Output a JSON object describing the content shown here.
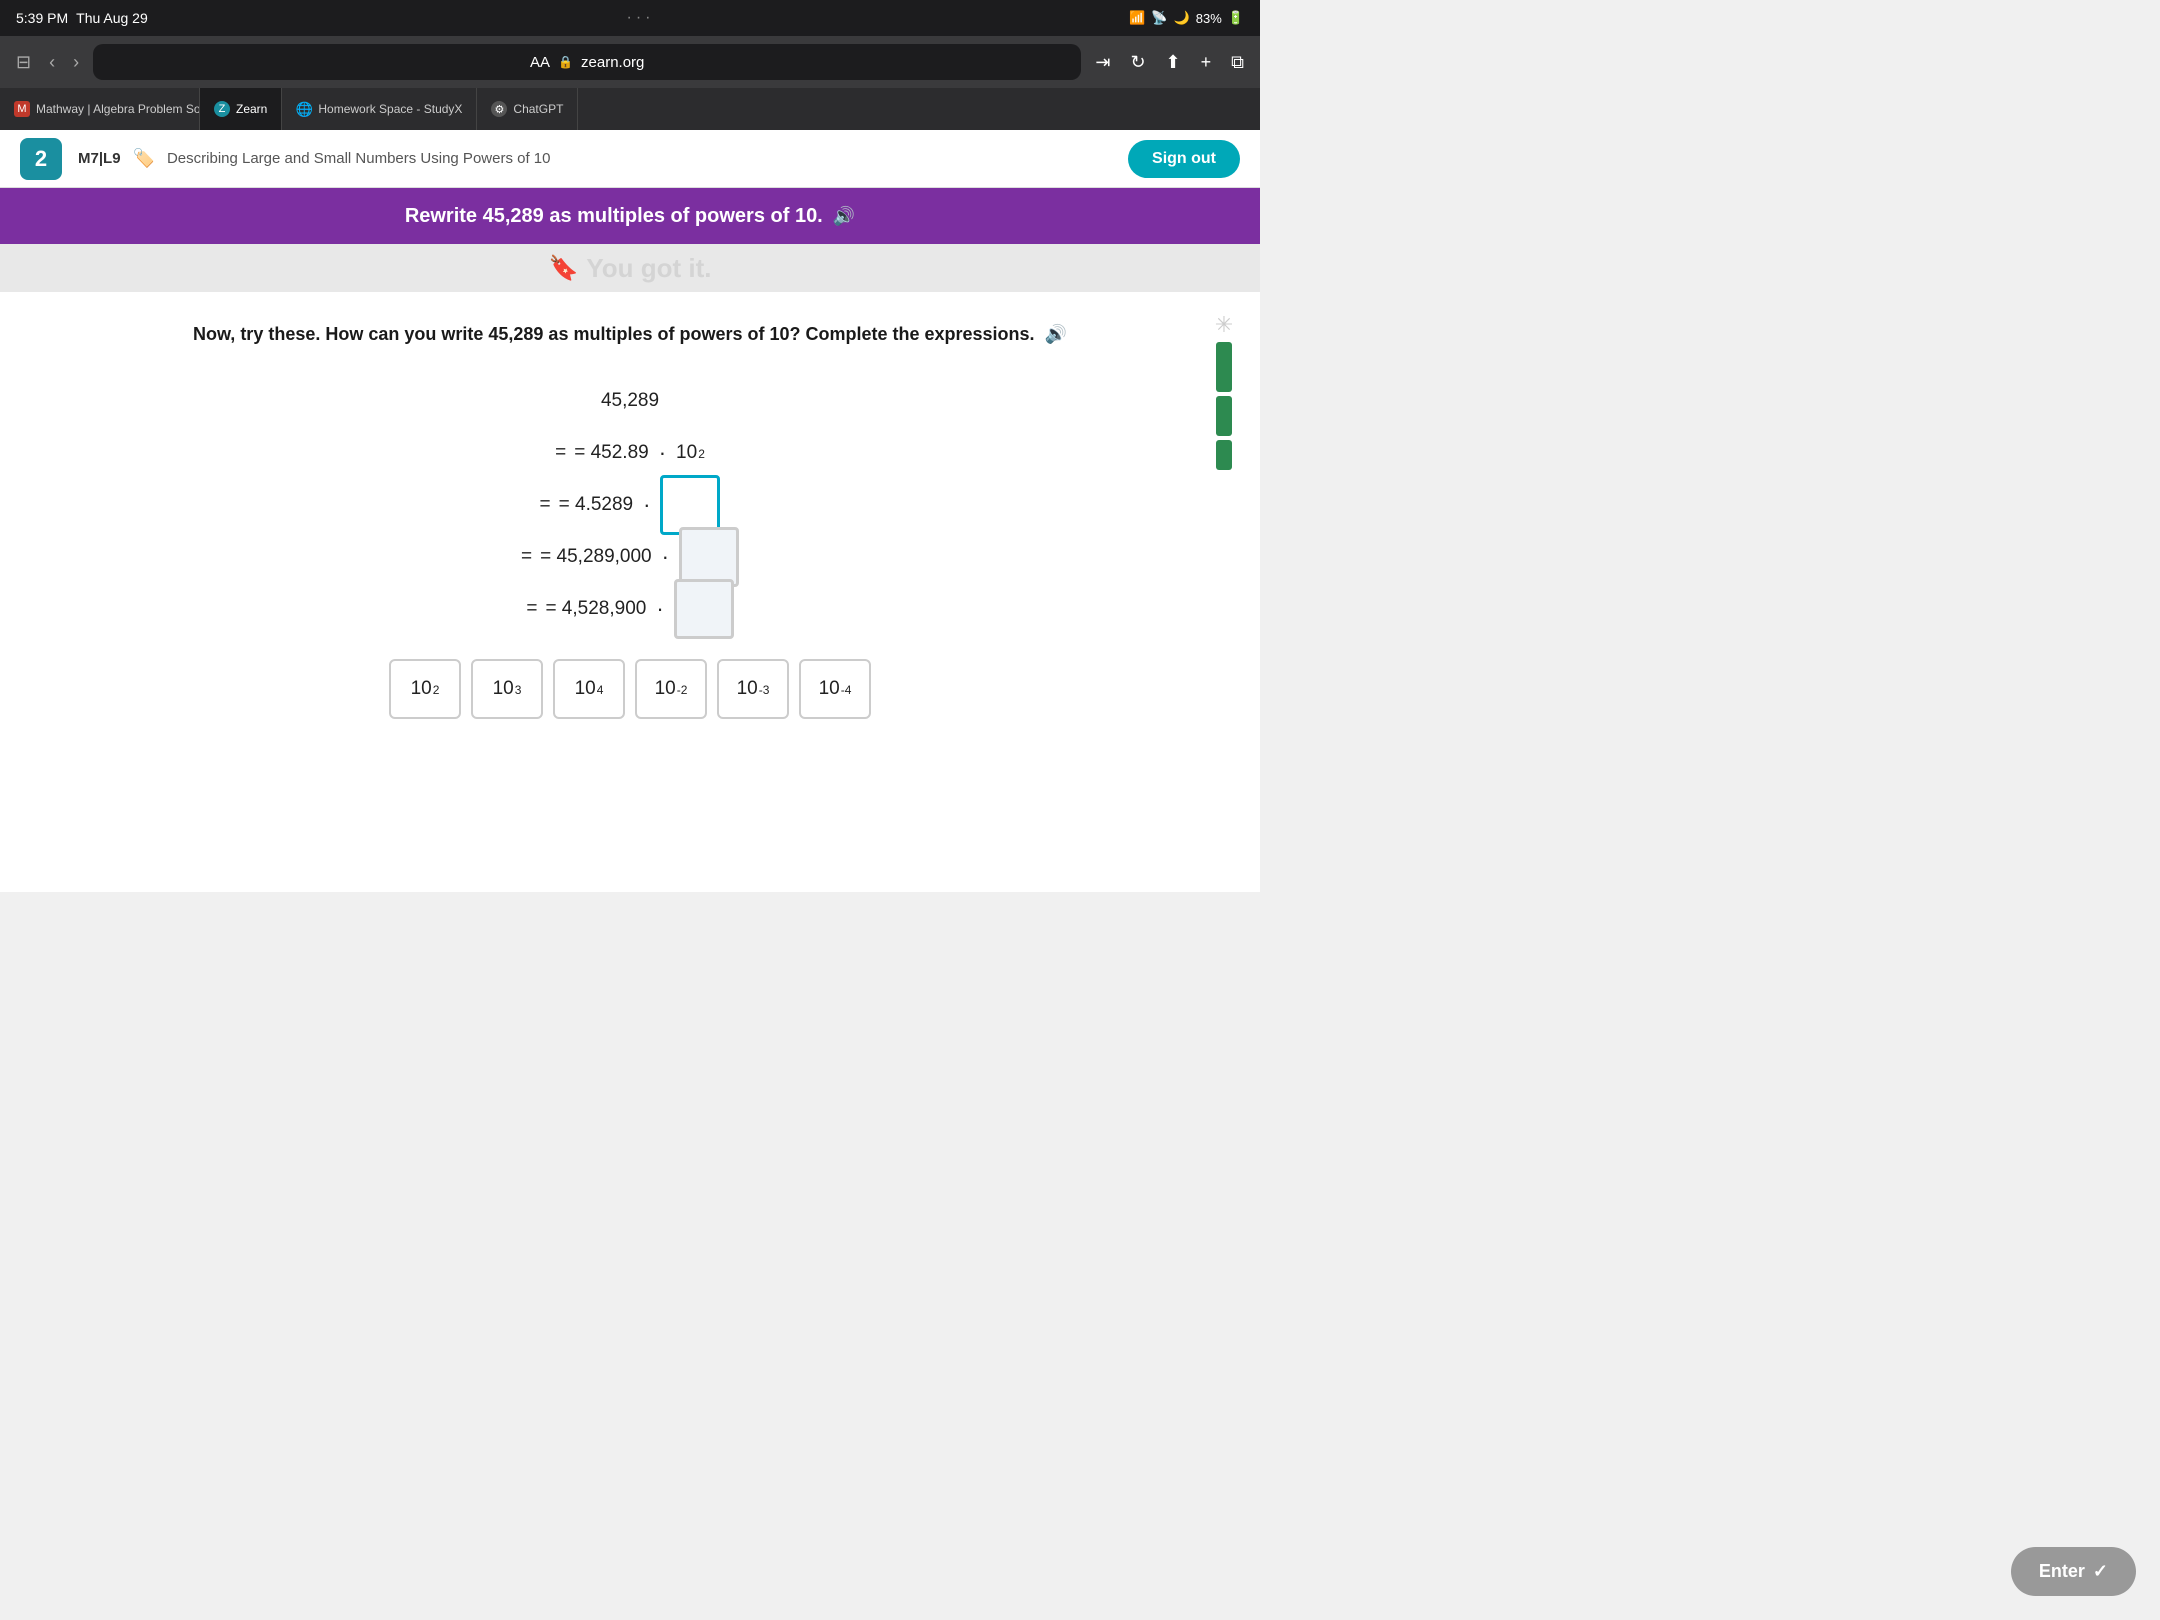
{
  "status_bar": {
    "time": "5:39 PM",
    "date": "Thu Aug 29",
    "signal": "●●●●",
    "wifi": "WiFi",
    "mode": "🌙",
    "battery": "83%"
  },
  "browser": {
    "aa_label": "AA",
    "url": "zearn.org",
    "dots": "···"
  },
  "tabs": [
    {
      "id": "mathway",
      "label": "Mathway | Algebra Problem So...",
      "icon": "M",
      "icon_color": "#c0392b",
      "active": false,
      "closeable": true
    },
    {
      "id": "zearn",
      "label": "Zearn",
      "icon": "Z",
      "icon_color": "#1a8fa0",
      "active": true,
      "closeable": false
    },
    {
      "id": "homework",
      "label": "Homework Space - StudyX",
      "icon": "🌐",
      "icon_color": "#6060c0",
      "active": false,
      "closeable": false
    },
    {
      "id": "chatgpt",
      "label": "ChatGPT",
      "icon": "⚙",
      "icon_color": "#555",
      "active": false,
      "closeable": false
    }
  ],
  "nav": {
    "lesson_code": "M7|L9",
    "lesson_title": "Describing Large and Small Numbers Using Powers of 10",
    "sign_out": "Sign out"
  },
  "banner": {
    "text": "Rewrite 45,289 as multiples of powers of 10.",
    "sound_icon": "🔊"
  },
  "got_it": {
    "text": "You got it."
  },
  "instructions": {
    "text": "Now, try these. How can you write 45,289 as multiples of powers of 10? Complete the expressions.",
    "sound_icon": "🔊"
  },
  "math": {
    "number": "45,289",
    "rows": [
      {
        "id": "row1",
        "left": "= 452.89",
        "dot": "·",
        "right_type": "power",
        "base": "10",
        "exp": "2",
        "input": false
      },
      {
        "id": "row2",
        "left": "= 4.5289",
        "dot": "·",
        "right_type": "box",
        "highlighted": true,
        "input_value": ""
      },
      {
        "id": "row3",
        "left": "= 45,289,000",
        "dot": "·",
        "right_type": "box",
        "highlighted": false,
        "input_value": ""
      },
      {
        "id": "row4",
        "left": "= 4,528,900",
        "dot": "·",
        "right_type": "box",
        "highlighted": false,
        "input_value": ""
      }
    ]
  },
  "tiles": [
    {
      "id": "t1",
      "base": "10",
      "exp": "2"
    },
    {
      "id": "t2",
      "base": "10",
      "exp": "3"
    },
    {
      "id": "t3",
      "base": "10",
      "exp": "4"
    },
    {
      "id": "t4",
      "base": "10",
      "exp": "-2"
    },
    {
      "id": "t5",
      "base": "10",
      "exp": "-3"
    },
    {
      "id": "t6",
      "base": "10",
      "exp": "-4"
    }
  ],
  "enter_button": {
    "label": "Enter",
    "check": "✓"
  }
}
